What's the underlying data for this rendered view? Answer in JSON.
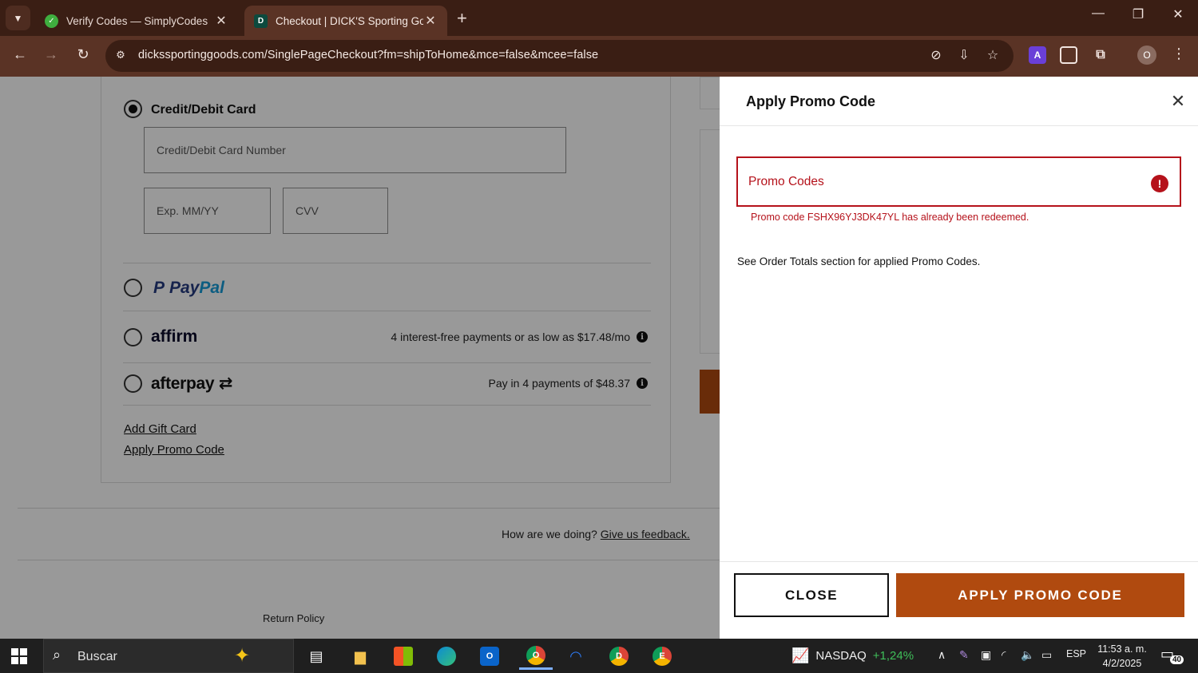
{
  "browser": {
    "tabs": [
      {
        "title": "Verify Codes — SimplyCodes",
        "favicon": "simplycodes-icon",
        "active": false
      },
      {
        "title": "Checkout | DICK'S Sporting Goo",
        "favicon": "dicks-icon",
        "active": true
      }
    ],
    "new_tab_glyph": "+",
    "url": "dickssportinggoods.com/SinglePageCheckout?fm=shipToHome&mce=false&mcee=false",
    "profile_initial": "O"
  },
  "checkout": {
    "credit_card_label": "Credit/Debit Card",
    "card_number_placeholder": "Credit/Debit Card Number",
    "exp_placeholder": "Exp. MM/YY",
    "cvv_placeholder": "CVV",
    "paypal_brand": {
      "part1": "Pay",
      "part2": "Pal"
    },
    "affirm_brand": "affirm",
    "affirm_info": "4 interest-free payments or as low as $17.48/mo",
    "afterpay_brand": "afterpay",
    "afterpay_info": "Pay in 4 payments of $48.37",
    "add_gift_card": "Add Gift Card",
    "apply_promo_code_link": "Apply Promo Code",
    "feedback_prefix": "How are we doing?",
    "feedback_link": "Give us feedback.",
    "return_policy": "Return Policy"
  },
  "promo_panel": {
    "title": "Apply Promo Code",
    "input_placeholder": "Promo Codes",
    "error_message": "Promo code FSHX96YJ3DK47YL has already been redeemed.",
    "note": "See Order Totals section for applied Promo Codes.",
    "close_button": "CLOSE",
    "apply_button": "APPLY PROMO CODE"
  },
  "taskbar": {
    "search_text": "Buscar",
    "stock_name": "NASDAQ",
    "stock_change": "+1,24%",
    "language": "ESP",
    "time": "11:53 a. m.",
    "date": "4/2/2025",
    "notification_count": "40",
    "badges": {
      "chrome1": "O",
      "chrome2": "D",
      "chrome3": "E"
    }
  },
  "colors": {
    "brand_orange": "#b04a0f",
    "error_red": "#b5121b",
    "chrome_dark": "#3a1e14",
    "chrome_toolbar": "#5a3325"
  }
}
